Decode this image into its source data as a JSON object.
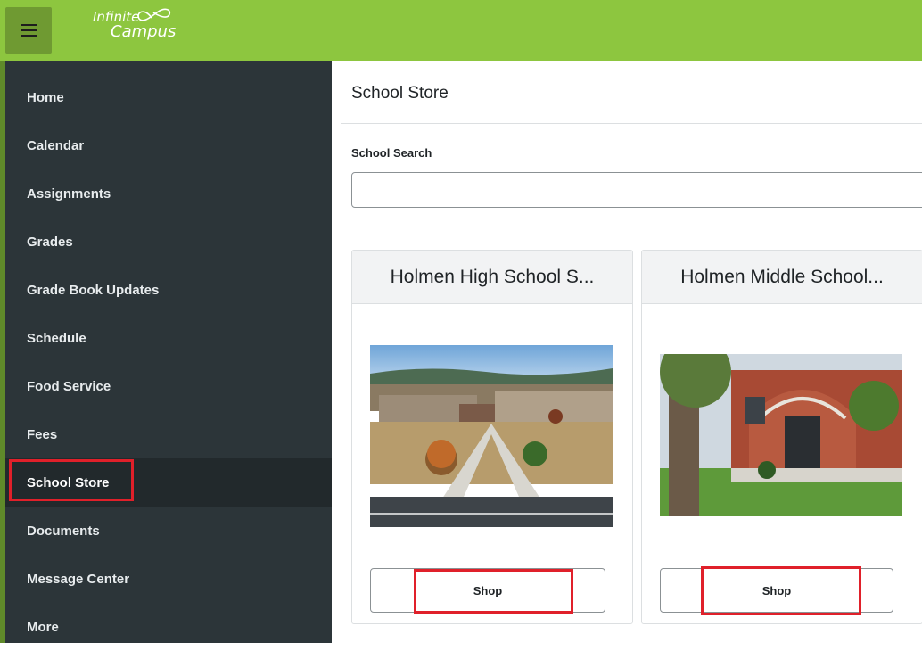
{
  "app": {
    "logo_line1": "Infinite",
    "logo_line2": "Campus",
    "menu_icon": "hamburger-menu-icon"
  },
  "colors": {
    "topbar": "#8dc63f",
    "sidebar": "#2c3539",
    "highlight": "#e0202a"
  },
  "sidebar": {
    "items": [
      {
        "label": "Home"
      },
      {
        "label": "Calendar"
      },
      {
        "label": "Assignments"
      },
      {
        "label": "Grades"
      },
      {
        "label": "Grade Book Updates"
      },
      {
        "label": "Schedule"
      },
      {
        "label": "Food Service"
      },
      {
        "label": "Fees"
      },
      {
        "label": "School Store",
        "active": true
      },
      {
        "label": "Documents"
      },
      {
        "label": "Message Center"
      },
      {
        "label": "More"
      }
    ]
  },
  "main": {
    "title": "School Store",
    "search": {
      "label": "School Search",
      "value": "",
      "placeholder": ""
    },
    "stores": [
      {
        "name": "Holmen High School S...",
        "button": "Shop"
      },
      {
        "name": "Holmen Middle School...",
        "button": "Shop"
      }
    ]
  }
}
